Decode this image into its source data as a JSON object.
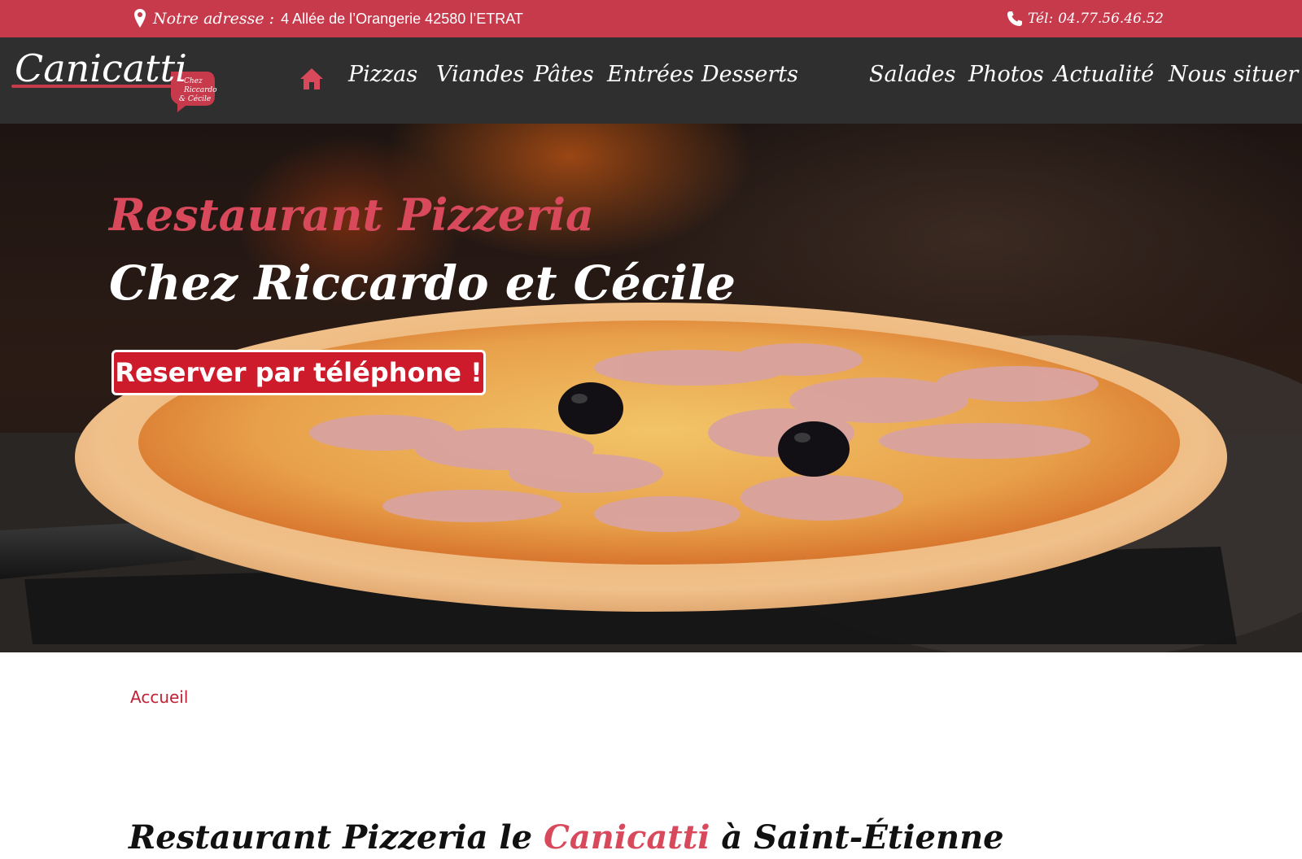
{
  "topbar": {
    "address_label": "Notre adresse :",
    "address_value": "4 Allée de l’Orangerie 42580 l’ETRAT",
    "phone_label": "Tél:",
    "phone_value": "04.77.56.46.52"
  },
  "logo": {
    "name": "Canicatti",
    "sub1": "Chez",
    "sub2": "Riccardo",
    "sub3": "& Cécile"
  },
  "nav": {
    "items": [
      {
        "label": "Pizzas"
      },
      {
        "label": "Viandes"
      },
      {
        "label": "Pâtes"
      },
      {
        "label": "Entrées"
      },
      {
        "label": "Desserts"
      },
      {
        "label": "Salades"
      },
      {
        "label": "Photos"
      },
      {
        "label": "Actualité"
      },
      {
        "label": "Nous situer"
      }
    ]
  },
  "hero": {
    "title_line1": "Restaurant Pizzeria",
    "title_line2": "Chez Riccardo et Cécile",
    "cta_label": "Reserver par téléphone !"
  },
  "breadcrumb": "Accueil",
  "section": {
    "title_prefix": "Restaurant Pizzeria le ",
    "title_accent": "Canicatti",
    "title_suffix": " à Saint-Étienne"
  },
  "colors": {
    "brand_red": "#c73a4c",
    "nav_bg": "#2f2f2f",
    "cta_red": "#cd1b2c",
    "accent_text": "#d9495c"
  },
  "icons": {
    "address": "map-pin-icon",
    "phone": "phone-icon",
    "home": "home-icon"
  }
}
